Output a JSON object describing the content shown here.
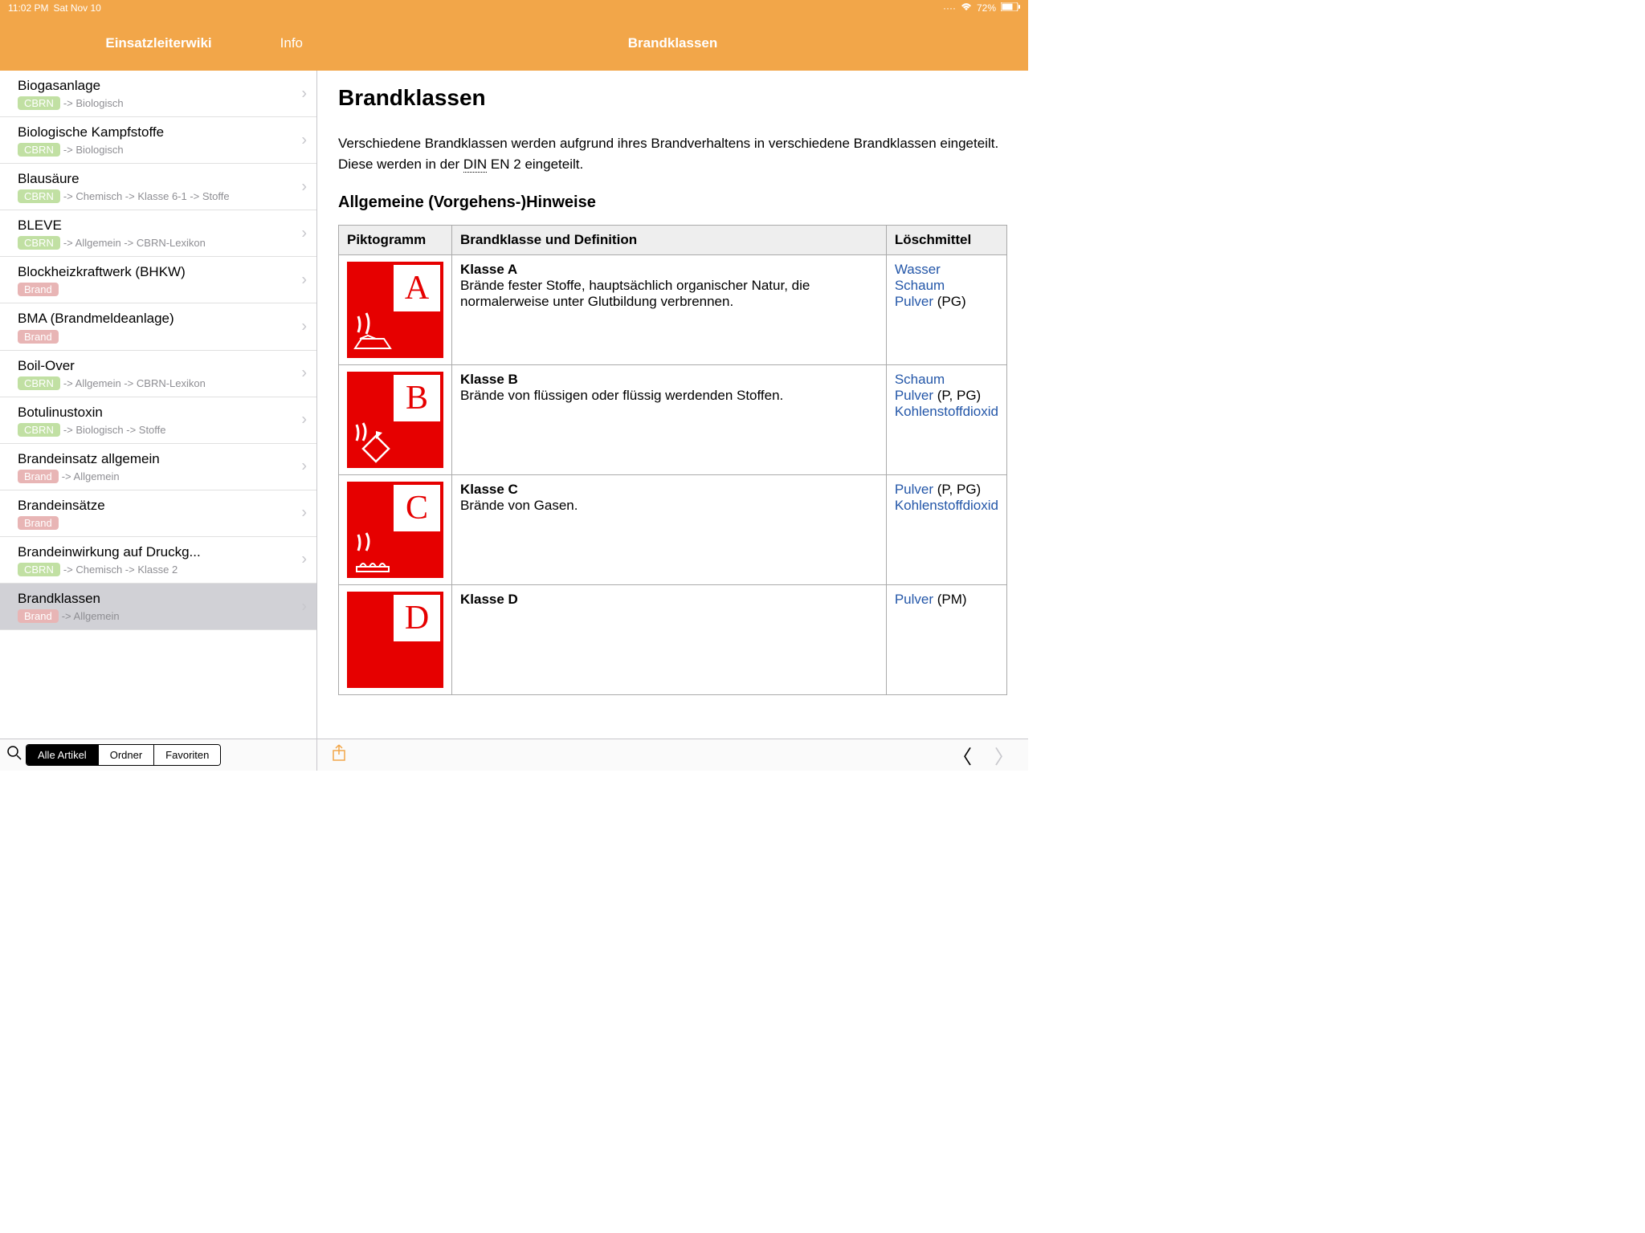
{
  "status": {
    "time": "11:02 PM",
    "date": "Sat Nov 10",
    "battery": "72%"
  },
  "header": {
    "sidebar_title": "Einsatzleiterwiki",
    "info": "Info",
    "page_title": "Brandklassen"
  },
  "sidebar": {
    "items": [
      {
        "title": "Biogasanlage",
        "tag": "CBRN",
        "tag_class": "cbrn",
        "crumb": "-> Biologisch"
      },
      {
        "title": "Biologische Kampfstoffe",
        "tag": "CBRN",
        "tag_class": "cbrn",
        "crumb": "-> Biologisch"
      },
      {
        "title": "Blausäure",
        "tag": "CBRN",
        "tag_class": "cbrn",
        "crumb": "-> Chemisch -> Klasse 6-1 -> Stoffe"
      },
      {
        "title": "BLEVE",
        "tag": "CBRN",
        "tag_class": "cbrn",
        "crumb": "-> Allgemein -> CBRN-Lexikon"
      },
      {
        "title": "Blockheizkraftwerk (BHKW)",
        "tag": "Brand",
        "tag_class": "brand",
        "crumb": ""
      },
      {
        "title": "BMA (Brandmeldeanlage)",
        "tag": "Brand",
        "tag_class": "brand",
        "crumb": ""
      },
      {
        "title": "Boil-Over",
        "tag": "CBRN",
        "tag_class": "cbrn",
        "crumb": "-> Allgemein -> CBRN-Lexikon"
      },
      {
        "title": "Botulinustoxin",
        "tag": "CBRN",
        "tag_class": "cbrn",
        "crumb": "-> Biologisch -> Stoffe"
      },
      {
        "title": "Brandeinsatz allgemein",
        "tag": "Brand",
        "tag_class": "brand",
        "crumb": "-> Allgemein"
      },
      {
        "title": "Brandeinsätze",
        "tag": "Brand",
        "tag_class": "brand",
        "crumb": ""
      },
      {
        "title": "Brandeinwirkung auf Druckg...",
        "tag": "CBRN",
        "tag_class": "cbrn",
        "crumb": "-> Chemisch -> Klasse 2"
      },
      {
        "title": "Brandklassen",
        "tag": "Brand",
        "tag_class": "brand",
        "crumb": "-> Allgemein",
        "selected": true
      }
    ]
  },
  "article": {
    "h1": "Brandklassen",
    "intro_pre": "Verschiedene Brandklassen werden aufgrund ihres Brandverhaltens in verschiedene Brandklassen eingeteilt. Diese werden in der ",
    "intro_din": "DIN",
    "intro_post": " EN 2 eingeteilt.",
    "h2": "Allgemeine (Vorgehens-)Hinweise",
    "table": {
      "headers": [
        "Piktogramm",
        "Brandklasse und Definition",
        "Löschmittel"
      ],
      "rows": [
        {
          "letter": "A",
          "klass": "Klasse A",
          "def": "Brände fester Stoffe, hauptsächlich organischer Natur, die normalerweise unter Glutbildung verbrennen.",
          "loesch": [
            {
              "t": "Wasser",
              "link": true
            },
            {
              "t": "Schaum",
              "link": true
            },
            {
              "t": "Pulver",
              "link": true,
              "suffix": " (PG)"
            }
          ]
        },
        {
          "letter": "B",
          "klass": "Klasse B",
          "def": "Brände von flüssigen oder flüssig werdenden Stoffen.",
          "loesch": [
            {
              "t": "Schaum",
              "link": true
            },
            {
              "t": "Pulver",
              "link": true,
              "suffix": " (P, PG)"
            },
            {
              "t": "Kohlenstoffdioxid",
              "link": true
            }
          ]
        },
        {
          "letter": "C",
          "klass": "Klasse C",
          "def": "Brände von Gasen.",
          "loesch": [
            {
              "t": "Pulver",
              "link": true,
              "suffix": " (P, PG)"
            },
            {
              "t": "Kohlenstoffdioxid",
              "link": true
            }
          ]
        },
        {
          "letter": "D",
          "klass": "Klasse D",
          "def": "",
          "loesch": [
            {
              "t": "Pulver",
              "link": true,
              "suffix": " (PM)"
            }
          ]
        }
      ]
    }
  },
  "bottom": {
    "seg": [
      "Alle Artikel",
      "Ordner",
      "Favoriten"
    ],
    "active": 0
  }
}
